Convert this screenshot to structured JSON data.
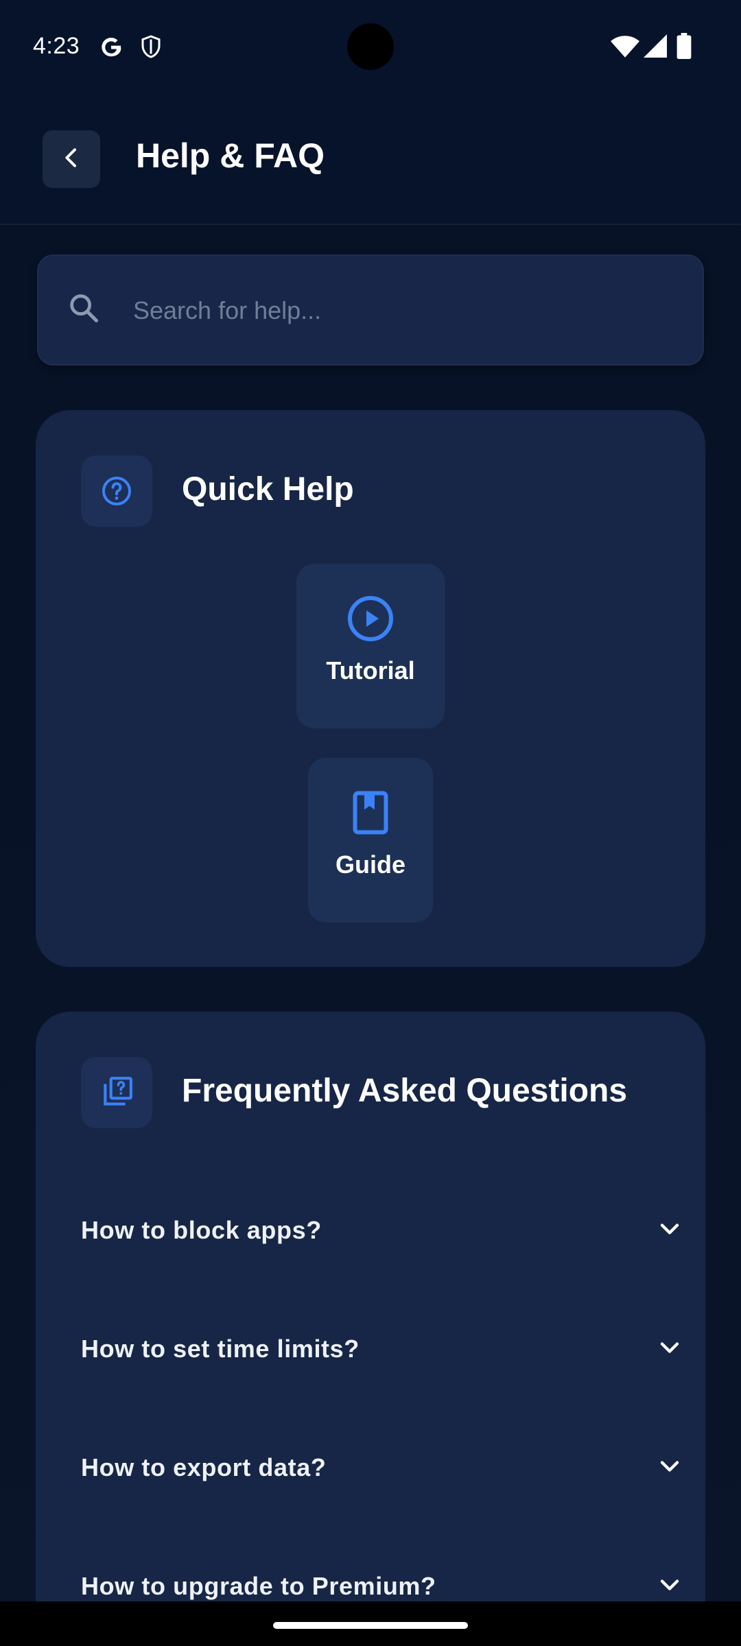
{
  "status_bar": {
    "time": "4:23",
    "left_icons": [
      "google-icon",
      "shield-icon"
    ],
    "right_icons": [
      "wifi-icon",
      "signal-icon",
      "battery-icon"
    ]
  },
  "app_bar": {
    "title": "Help & FAQ",
    "back_icon": "chevron-left-icon"
  },
  "search": {
    "placeholder": "Search for help...",
    "value": ""
  },
  "quick_help": {
    "title": "Quick Help",
    "icon": "help-circle-icon",
    "items": [
      {
        "label": "Tutorial",
        "icon": "play-circle-icon"
      },
      {
        "label": "Guide",
        "icon": "book-icon"
      }
    ]
  },
  "faq": {
    "title": "Frequently Asked Questions",
    "icon": "quiz-icon",
    "items": [
      {
        "question": "How to block apps?",
        "expanded": false
      },
      {
        "question": "How to set time limits?",
        "expanded": false
      },
      {
        "question": "How to export data?",
        "expanded": false
      },
      {
        "question": "How to upgrade to Premium?",
        "expanded": false
      }
    ]
  },
  "colors": {
    "background": "#071228",
    "card": "#172646",
    "accent": "#3b82f6",
    "text_primary": "#ffffff",
    "placeholder": "#717e95"
  }
}
